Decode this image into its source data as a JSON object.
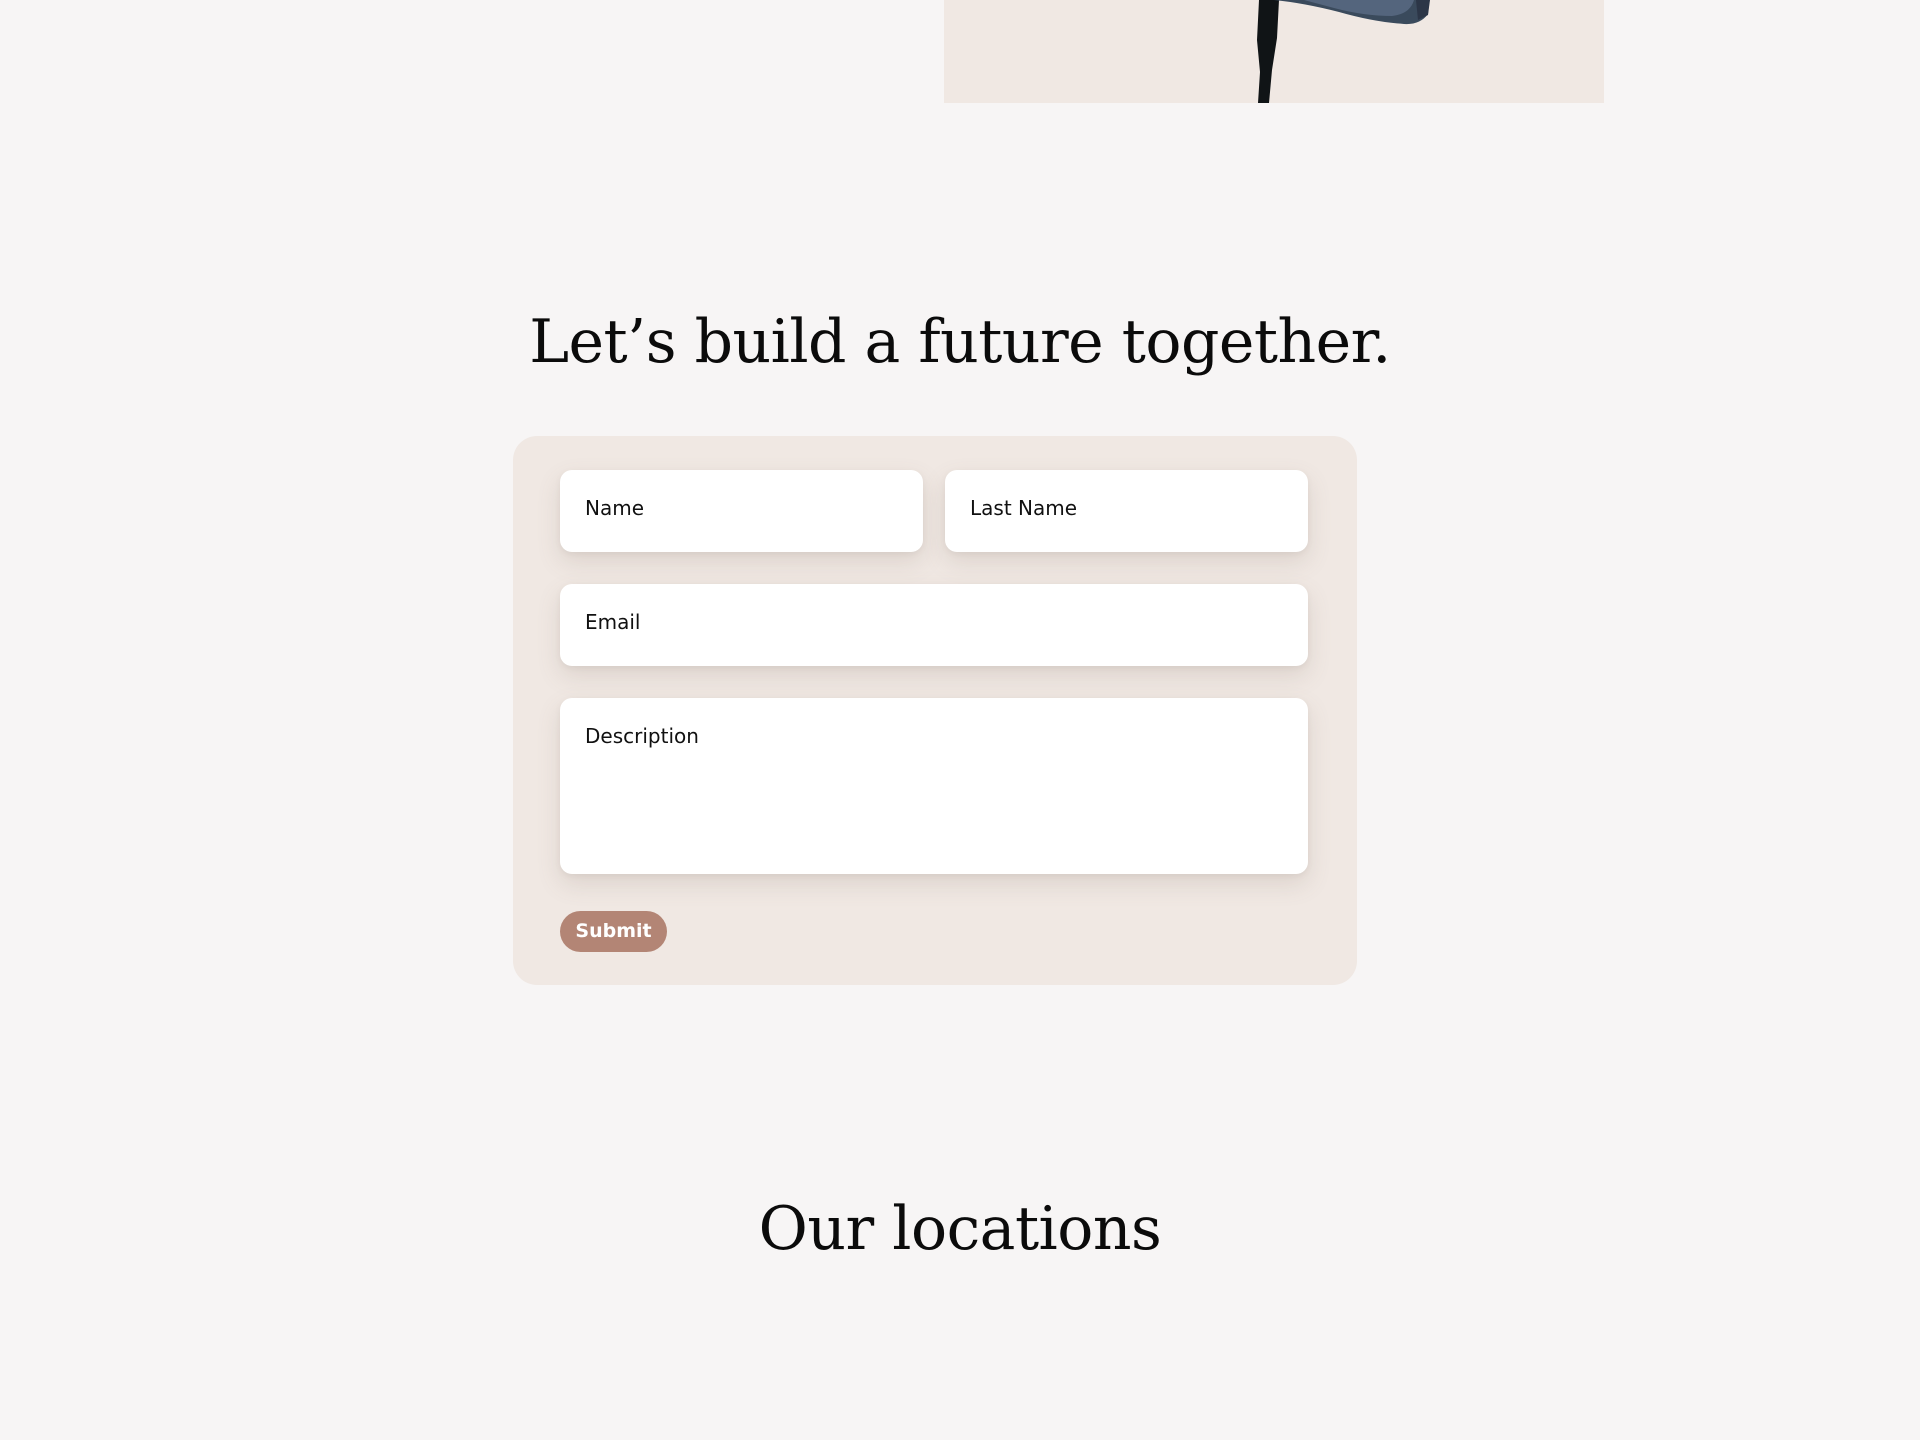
{
  "hero": {
    "image_alt": "person-illustration",
    "bg_color": "#f0e8e3"
  },
  "contact": {
    "heading": "Let’s build a future together.",
    "fields": {
      "name_placeholder": "Name",
      "last_name_placeholder": "Last Name",
      "email_placeholder": "Email",
      "description_placeholder": "Description"
    },
    "submit_label": "Submit",
    "card_color": "#f0e8e3",
    "button_color": "#b38575"
  },
  "locations": {
    "heading": "Our locations"
  }
}
